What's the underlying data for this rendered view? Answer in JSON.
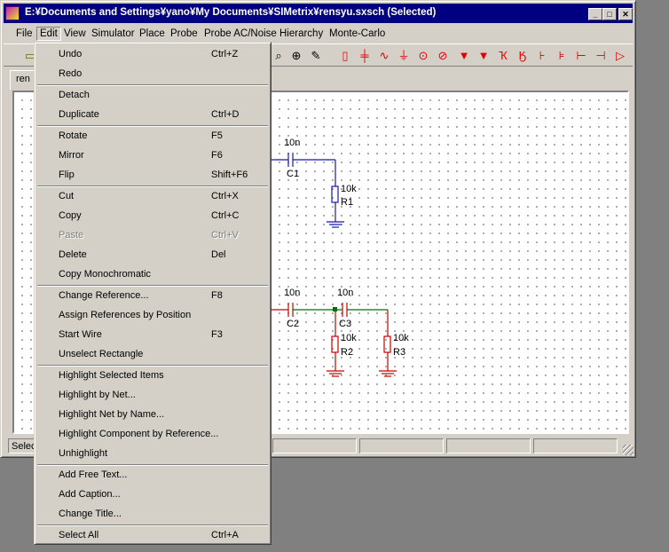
{
  "window": {
    "title": "E:¥Documents and Settings¥yano¥My Documents¥SIMetrix¥rensyu.sxsch (Selected)",
    "minimize": "_",
    "maximize": "□",
    "close": "✕"
  },
  "menubar": {
    "items": [
      "File",
      "Edit",
      "View",
      "Simulator",
      "Place",
      "Probe",
      "Probe AC/Noise",
      "Hierarchy",
      "Monte-Carlo"
    ]
  },
  "tabs": [
    "ren"
  ],
  "status": {
    "cell0": "Selec"
  },
  "schematic": {
    "c1": {
      "value": "10n",
      "ref": "C1"
    },
    "r1": {
      "value": "10k",
      "ref": "R1"
    },
    "c2": {
      "value": "10n",
      "ref": "C2"
    },
    "c3": {
      "value": "10n",
      "ref": "C3"
    },
    "r2": {
      "value": "10k",
      "ref": "R2"
    },
    "r3": {
      "value": "10k",
      "ref": "R3"
    },
    "colors": {
      "blue": "#1818a8",
      "red": "#cc0000",
      "green": "#007000"
    }
  },
  "edit_menu": {
    "items": [
      {
        "label": "Undo",
        "shortcut": "Ctrl+Z",
        "enabled": true
      },
      {
        "label": "Redo",
        "shortcut": "",
        "enabled": true
      },
      {
        "label": "Detach",
        "shortcut": "",
        "enabled": true
      },
      {
        "label": "Duplicate",
        "shortcut": "Ctrl+D",
        "enabled": true
      },
      {
        "label": "Rotate",
        "shortcut": "F5",
        "enabled": true
      },
      {
        "label": "Mirror",
        "shortcut": "F6",
        "enabled": true
      },
      {
        "label": "Flip",
        "shortcut": "Shift+F6",
        "enabled": true
      },
      {
        "label": "Cut",
        "shortcut": "Ctrl+X",
        "enabled": true
      },
      {
        "label": "Copy",
        "shortcut": "Ctrl+C",
        "enabled": true
      },
      {
        "label": "Paste",
        "shortcut": "Ctrl+V",
        "enabled": false
      },
      {
        "label": "Delete",
        "shortcut": "Del",
        "enabled": true
      },
      {
        "label": "Copy Monochromatic",
        "shortcut": "",
        "enabled": true
      },
      {
        "label": "Change Reference...",
        "shortcut": "F8",
        "enabled": true
      },
      {
        "label": "Assign References by Position",
        "shortcut": "",
        "enabled": true
      },
      {
        "label": "Start Wire",
        "shortcut": "F3",
        "enabled": true
      },
      {
        "label": "Unselect Rectangle",
        "shortcut": "",
        "enabled": true
      },
      {
        "label": "Highlight Selected Items",
        "shortcut": "",
        "enabled": true
      },
      {
        "label": "Highlight by Net...",
        "shortcut": "",
        "enabled": true
      },
      {
        "label": "Highlight Net by Name...",
        "shortcut": "",
        "enabled": true
      },
      {
        "label": "Highlight Component by Reference...",
        "shortcut": "",
        "enabled": true
      },
      {
        "label": "Unhighlight",
        "shortcut": "",
        "enabled": true
      },
      {
        "label": "Add Free Text...",
        "shortcut": "",
        "enabled": true
      },
      {
        "label": "Add Caption...",
        "shortcut": "",
        "enabled": true
      },
      {
        "label": "Change Title...",
        "shortcut": "",
        "enabled": true
      },
      {
        "label": "Select All",
        "shortcut": "Ctrl+A",
        "enabled": true
      }
    ]
  }
}
